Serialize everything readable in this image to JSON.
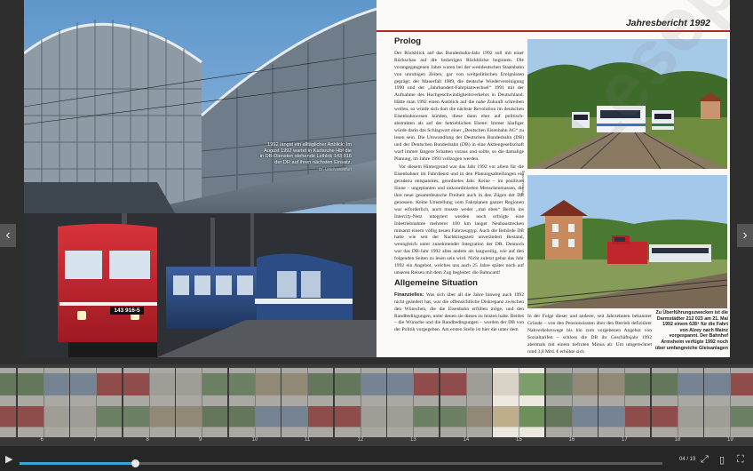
{
  "window": {
    "title": "Jahresbericht 1992"
  },
  "left_page": {
    "caption": "1992 längst ein alltäglicher Anblick: Im August 1992 wartet in Karlsruhe Hbf die in DB-Diensten stehende Leihlok 143 916 der DR auf ihren nächsten Einsatz.",
    "credit": "Dr. Ulrich Montfort",
    "loco_number": "143 916-5"
  },
  "right_page": {
    "header_title": "Jahresbericht 1992",
    "section1_title": "Prolog",
    "section1_paragraphs": [
      "Der Rückblick auf das Bundesbahn-Jahr 1992 soll mit einer Rückschau auf die bisherigen Rückblicke beginnen. Die vorangegangenen Jahre waren bei der westdeutschen Staatsbahn von unruhigen Zeiten, gar von weltpolitischen Ereignissen geprägt: der Mauerfall 1989, die deutsche Wiedervereinigung 1990 und der „Jahrhundert-Fahrplanwechsel“ 1991 mit der Aufnahme des Hochgeschwindigkeitsverkehrs in Deutschland. Hätte man 1992 einen Ausblick auf die nahe Zukunft schreiben wollen, so würde sich dort die nächste Revolution im deutschen Eisenbahnwesen künden, diese dann eher auf politisch-abstrakten als auf der betrieblichen Ebene: Immer häufiger würde darin das Schlagwort einer „Deutschen Eisenbahn AG“ zu lesen sein. Die Umwandlung der Deutschen Bundesbahn (DB) und der Deutschen Bundesbahn (DB) in eine Aktiengesellschaft warf immer längere Schatten voraus und sollte, so die damalige Planung, im Jahre 1993 vollzogen werden.",
      "Vor diesem Hintergrund war das Jahr 1992 vor allem für die Eisenbahner im Fahrdienst und in den Planungsabteilungen ein geradezu entspanntes, geordnetes Jahr. Keine – im positiven Sinne – ungeplanten und unkoordinierten Menschenmassen, die ihre neue gesamtdeutsche Freiheit auch in den Zügen der DB genossen. Keine Umstellung vom Fahrplanen ganzer Regionen war erforderlich, auch musste weder „mal eben“ Berlin ins Intercity-Netz integriert werden noch erfolgte eine Inbetriebnahme mehrerer 100 km langer Neubaustrecken mitsamt einem völlig neuen Fahrzeugtyp. Auch die Behörde DB hatte wie seit der Nachkriegszeit unverändert Bestand, wenngleich unter zunehmender Integration der DR. Dennoch war das DB-Jahr 1992 alles andere als langweilig, wie auf den folgenden Seiten zu lesen sein wird. Nicht zuletzt gebar das Jahr 1992 ein Angebot, welches uns auch 25 Jahre später noch auf unseren Reisen mit dem Zug begleitet: die Bahncard!"
    ],
    "section2_title": "Allgemeine Situation",
    "section2_lead": "Finanzielles:",
    "section2_text": "Was sich über all die Jahre hinweg auch 1992 nicht geändert hat, war die offensichtliche Diskrepanz zwischen den Wünschen, die die Eisenbahn erfüllen möge, und den Randbedingungen, unter denen sie dieses zu leisten habe. Beides – die Wünsche und die Randbedingungen – wurden der DB von der Politik vorgegeben. Am ersten Stelle ist hier die unter dem",
    "column2_text": "In der Folge dieser und anderer, seit Jahrzehnten bekannter Gründe – von den Pensionslasten über den Betrieb defizitärer Nahverkehrswege bis hin zum vorgebenen Angebot von Sozialtarifen – schloss die DB ihr Geschäftsjahr 1992 abermals mit einem tiefroten Minus ab: Um umgerechnet rund 3,8 Mrd. € erhöhte sich",
    "photo_credit": "Thomas Kräling",
    "photo2_caption": "Zu Überführungszwecken ist die Darmstädter 212 023 am 21. Mai 1992 einem 628⁴ für die Fahrt von Alzey nach Mainz vorgespannt. Der Bahnhof Armsheim verfügte 1992 noch über umfangreiche Gleisanlagen",
    "watermark": "Leseprobe"
  },
  "nav": {
    "prev_label": "‹",
    "next_label": "›"
  },
  "thumbnails": [
    {
      "label": "",
      "active": false
    },
    {
      "label": "6",
      "active": false
    },
    {
      "label": "7",
      "active": false
    },
    {
      "label": "8",
      "active": false
    },
    {
      "label": "9",
      "active": false
    },
    {
      "label": "10",
      "active": false
    },
    {
      "label": "11",
      "active": false
    },
    {
      "label": "12",
      "active": false
    },
    {
      "label": "13",
      "active": false
    },
    {
      "label": "14",
      "active": false
    },
    {
      "label": "15",
      "active": true
    },
    {
      "label": "16",
      "active": false
    },
    {
      "label": "17",
      "active": false
    },
    {
      "label": "18",
      "active": false
    },
    {
      "label": "19",
      "active": false
    }
  ],
  "controls": {
    "page_counter": "04 / 19",
    "progress_fraction": 0.18,
    "play_glyph": "▶",
    "fit_glyph": "⤢",
    "page_mode_glyph": "▯",
    "fullscreen_glyph": "⛶"
  },
  "colors": {
    "accent": "#3aa6d8",
    "header_rule": "#b02a22",
    "loco_red": "#c4212b"
  }
}
